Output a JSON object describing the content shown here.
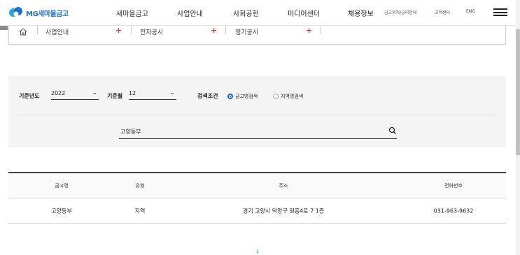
{
  "header": {
    "logo_text": "MG새마을금고",
    "nav": [
      "새마을금고",
      "사업안내",
      "사회공헌",
      "미디어센터",
      "채용정보"
    ],
    "util": [
      "금고위치/금리안내",
      "고객센터",
      "ENG"
    ]
  },
  "breadcrumb": {
    "items": [
      "사업안내",
      "전자공시",
      "정기공시"
    ]
  },
  "search": {
    "year_label": "기준년도",
    "year_value": "2022",
    "month_label": "기준월",
    "month_value": "12",
    "condition_label": "검색조건",
    "options": [
      "금고명검색",
      "지역명검색"
    ],
    "selected_option": "금고명검색",
    "query_value": "고양동부"
  },
  "table": {
    "columns": [
      "금고명",
      "유형",
      "주소",
      "전화번호"
    ],
    "rows": [
      [
        "고양동부",
        "지역",
        "경기 고양시 덕양구 원흥4로 7 1층",
        "031-963-9632"
      ]
    ]
  },
  "pagination": {
    "current": "1"
  },
  "colors": {
    "brand_blue": "#1e6fd0",
    "accent_orange": "#e1401e",
    "panel_bg": "#f4f4f4"
  }
}
